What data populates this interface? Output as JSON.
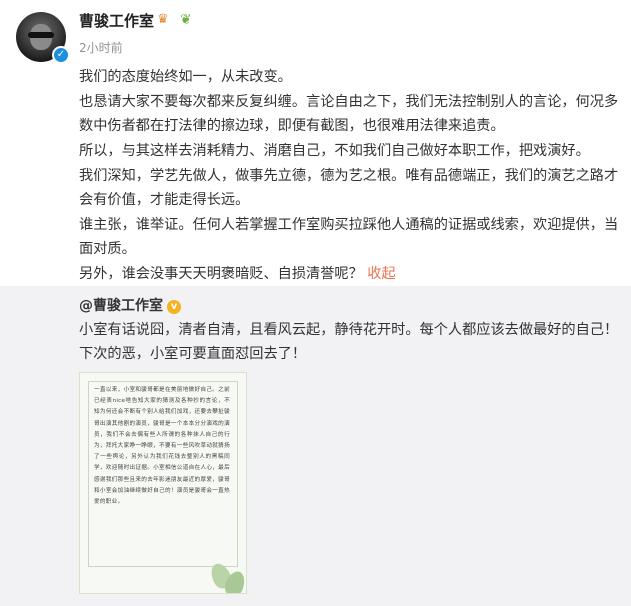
{
  "header": {
    "username": "曹骏工作室",
    "timestamp": "2小时前",
    "badge_icons": [
      "crown-badge-icon",
      "sprout-badge-icon"
    ],
    "verified_color": "#1d8fe1"
  },
  "post": {
    "paragraphs": [
      "我们的态度始终如一，从未改变。",
      "也恳请大家不要每次都来反复纠缠。言论自由之下，我们无法控制别人的言论，何况多数中伤者都在打法律的擦边球，即便有截图，也很难用法律来追责。",
      "所以，与其这样去消耗精力、消磨自己，不如我们自己做好本职工作，把戏演好。",
      "我们深知，学艺先做人，做事先立德，德为艺之根。唯有品德端正，我们的演艺之路才会有价值，才能走得长远。",
      "谁主张，谁举证。任何人若掌握工作室购买拉踩他人通稿的证据或线索，欢迎提供，当面对质。"
    ],
    "last_line": "另外，谁会没事天天明褒暗贬、自损清誉呢？",
    "collapse_label": "收起",
    "accent_color": "#eb7350"
  },
  "repost": {
    "username": "@曹骏工作室",
    "verified_badge_icon": "gold-verified-icon",
    "text": "小室有话说囧，清者自清，且看风云起，静待花开时。每个人都应该去做最好的自己！下次的恶，小室可要直面怼回去了！",
    "image_text": "一直以来，小室和骏哥都是在美丽地做好自己。之前已经表nice啥告知大家的猜测及各种抄的言论，不知为何还会不断有个别人给我们加戏，还要去攀扯骏哥出演其他剧的演员，骏哥是一个本本分分演戏的演员，我们不会去偶有些人所谓的各种抹人自己的行为，拜托大家睁一睁眼，不要有一些风吹草动就猜扬了一些舆论，另外认为我们花钱去整别人的黑稿同学，欢迎随时出证据。小室相信公道自在人心，最后感谢我们那些且来的去年影迷朋友最近的厚爱，骏哥和小室会加油继续做好自己的！演员是骏哥会一直热爱的职业。"
  }
}
